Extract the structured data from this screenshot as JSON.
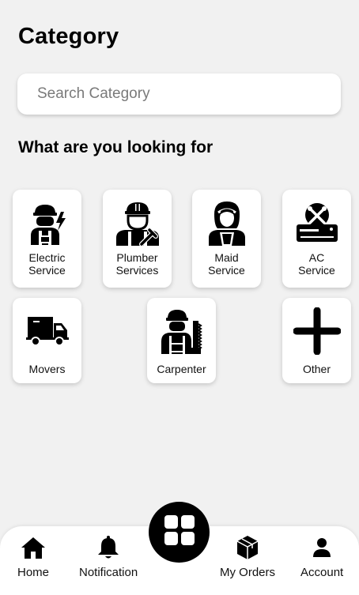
{
  "header": {
    "title": "Category"
  },
  "search": {
    "placeholder": "Search Category"
  },
  "section": {
    "title": "What are you looking for"
  },
  "categories": [
    {
      "label": "Electric\nService",
      "icon": "electrician-icon"
    },
    {
      "label": "Plumber\nServices",
      "icon": "plumber-icon"
    },
    {
      "label": "Maid\nService",
      "icon": "maid-icon"
    },
    {
      "label": "AC\nService",
      "icon": "ac-repair-icon"
    },
    {
      "label": "Movers",
      "icon": "moving-truck-icon"
    },
    {
      "label": "Carpenter",
      "icon": "carpenter-icon"
    },
    {
      "label": "Other",
      "icon": "plus-icon"
    }
  ],
  "bottom_nav": {
    "items": [
      {
        "label": "Home",
        "icon": "home-icon"
      },
      {
        "label": "Notification",
        "icon": "bell-icon"
      },
      {
        "label": "My Orders",
        "icon": "box-icon"
      },
      {
        "label": "Account",
        "icon": "user-icon"
      }
    ],
    "center_button": {
      "icon": "grid-icon"
    }
  },
  "colors": {
    "background": "#f1f1f1",
    "card": "#ffffff",
    "accent": "#000000"
  }
}
